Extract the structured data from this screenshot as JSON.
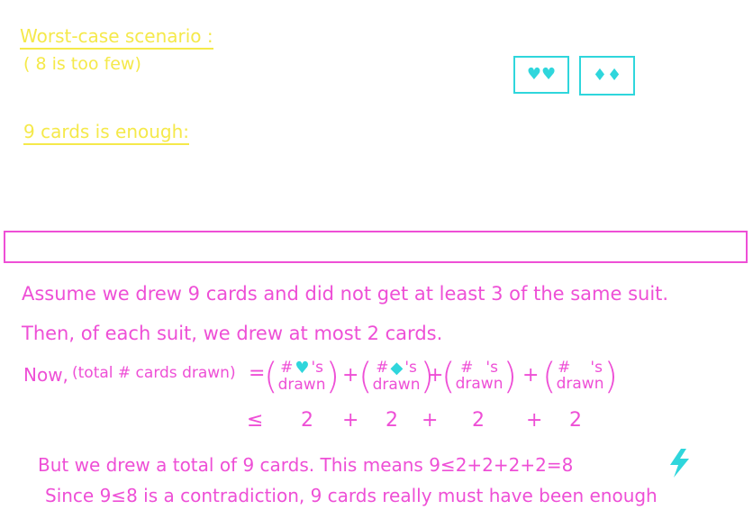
{
  "worst_case": {
    "title": "Worst-case scenario :",
    "subtitle": "( 8 is too few)"
  },
  "enough": {
    "title": "9 cards is enough:"
  },
  "cards": [
    {
      "symbols": "♥♥"
    },
    {
      "symbols": "♦♦"
    }
  ],
  "proof": {
    "line1": "Assume we drew 9 cards and did not get at least 3 of the same suit.",
    "line2": "Then, of each suit, we drew at most 2 cards.",
    "now_label": "Now,",
    "total_label": "(total # cards drawn)",
    "equals": "=",
    "plus": "+",
    "hash": "#",
    "apos_s": "'s",
    "drawn": "drawn",
    "suit_heart": "♥",
    "suit_diamond": "◆",
    "leq": "≤",
    "bound_values": [
      "2",
      "+",
      "2",
      "+",
      "2",
      "+",
      "2"
    ],
    "line4": "But we drew a total of 9 cards. This means 9≤2+2+2+2=8",
    "line5": "Since 9≤8 is a contradiction, 9 cards really must have been enough"
  },
  "colors": {
    "yellow": "#f5e94a",
    "magenta": "#ee4fd6",
    "cyan": "#2fd6dc"
  }
}
